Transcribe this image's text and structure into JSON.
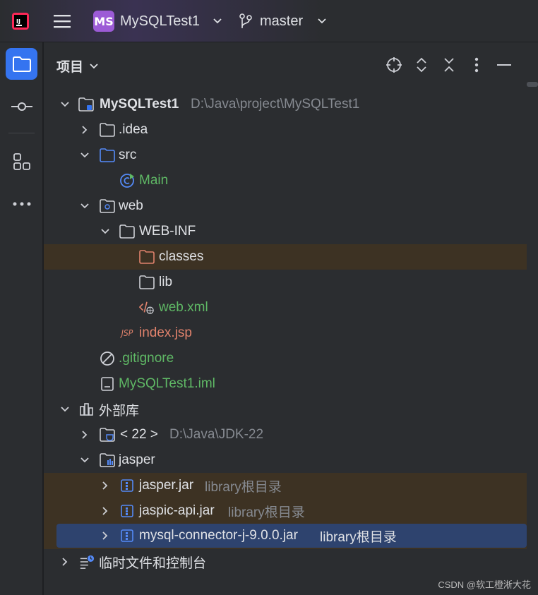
{
  "titlebar": {
    "project_badge": "MS",
    "project_name": "MySQLTest1",
    "branch_name": "master"
  },
  "panel": {
    "title": "项目"
  },
  "tree": {
    "root": {
      "label": "MySQLTest1",
      "path": "D:\\Java\\project\\MySQLTest1"
    },
    "idea": ".idea",
    "src": "src",
    "main": "Main",
    "web": "web",
    "webinf": "WEB-INF",
    "classes": "classes",
    "lib": "lib",
    "webxml": "web.xml",
    "indexjsp": "index.jsp",
    "gitignore": ".gitignore",
    "iml": "MySQLTest1.iml",
    "extlibs": "外部库",
    "jdk": {
      "label": "< 22 >",
      "path": "D:\\Java\\JDK-22"
    },
    "jasper": "jasper",
    "jars": [
      {
        "name": "jasper.jar",
        "note": "library根目录"
      },
      {
        "name": "jaspic-api.jar",
        "note": "library根目录"
      },
      {
        "name": "mysql-connector-j-9.0.0.jar",
        "note": "library根目录"
      }
    ],
    "scratches": "临时文件和控制台"
  },
  "watermark": "CSDN @软工橙淅大花",
  "colors": {
    "accent": "#3574f0",
    "green_text": "#5fb865",
    "orange_text": "#e0826c",
    "selection": "#2e436e",
    "highlight": "#3d3223"
  }
}
